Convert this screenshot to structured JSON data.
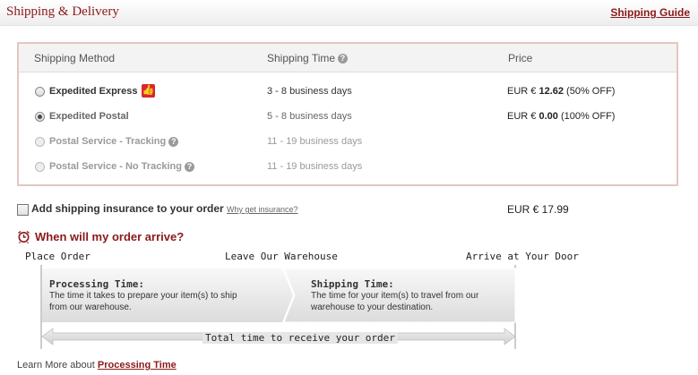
{
  "header": {
    "title": "Shipping & Delivery",
    "guide_link": "Shipping Guide"
  },
  "table": {
    "columns": {
      "method": "Shipping Method",
      "time": "Shipping Time",
      "price": "Price"
    },
    "rows": [
      {
        "name": "Expedited Express",
        "time": "3 - 8 business days",
        "price_prefix": "EUR € ",
        "price_value": "12.62",
        "price_note": " (50% OFF)",
        "selected": false,
        "enabled": true
      },
      {
        "name": "Expedited Postal",
        "time": "5 - 8 business days",
        "price_prefix": "EUR € ",
        "price_value": "0.00",
        "price_note": " (100% OFF)",
        "selected": true,
        "enabled": true
      },
      {
        "name": "Postal Service - Tracking",
        "time": "11 - 19 business days",
        "selected": false,
        "enabled": false
      },
      {
        "name": "Postal Service - No Tracking",
        "time": "11 - 19 business days",
        "selected": false,
        "enabled": false
      }
    ]
  },
  "insurance": {
    "label": "Add shipping insurance to your order",
    "link": "Why get insurance?",
    "price": "EUR € 17.99"
  },
  "arrival": {
    "title": "When will my order arrive?",
    "place_order": "Place Order",
    "leave_warehouse": "Leave Our Warehouse",
    "arrive_door": "Arrive at Your Door",
    "processing_title": "Processing Time:",
    "processing_text_1": "The time it takes to prepare your item(s) to ship",
    "processing_text_2": "from our warehouse.",
    "shipping_title": "Shipping Time:",
    "shipping_text_1": "The time  for your item(s) to travel from our",
    "shipping_text_2": "warehouse to your destination.",
    "total_label": "Total time to receive your order"
  },
  "learn_more": {
    "prefix": "Learn More about ",
    "link": "Processing Time"
  },
  "icons": {
    "help": "?",
    "thumb": "👍",
    "clock": "⏰"
  }
}
